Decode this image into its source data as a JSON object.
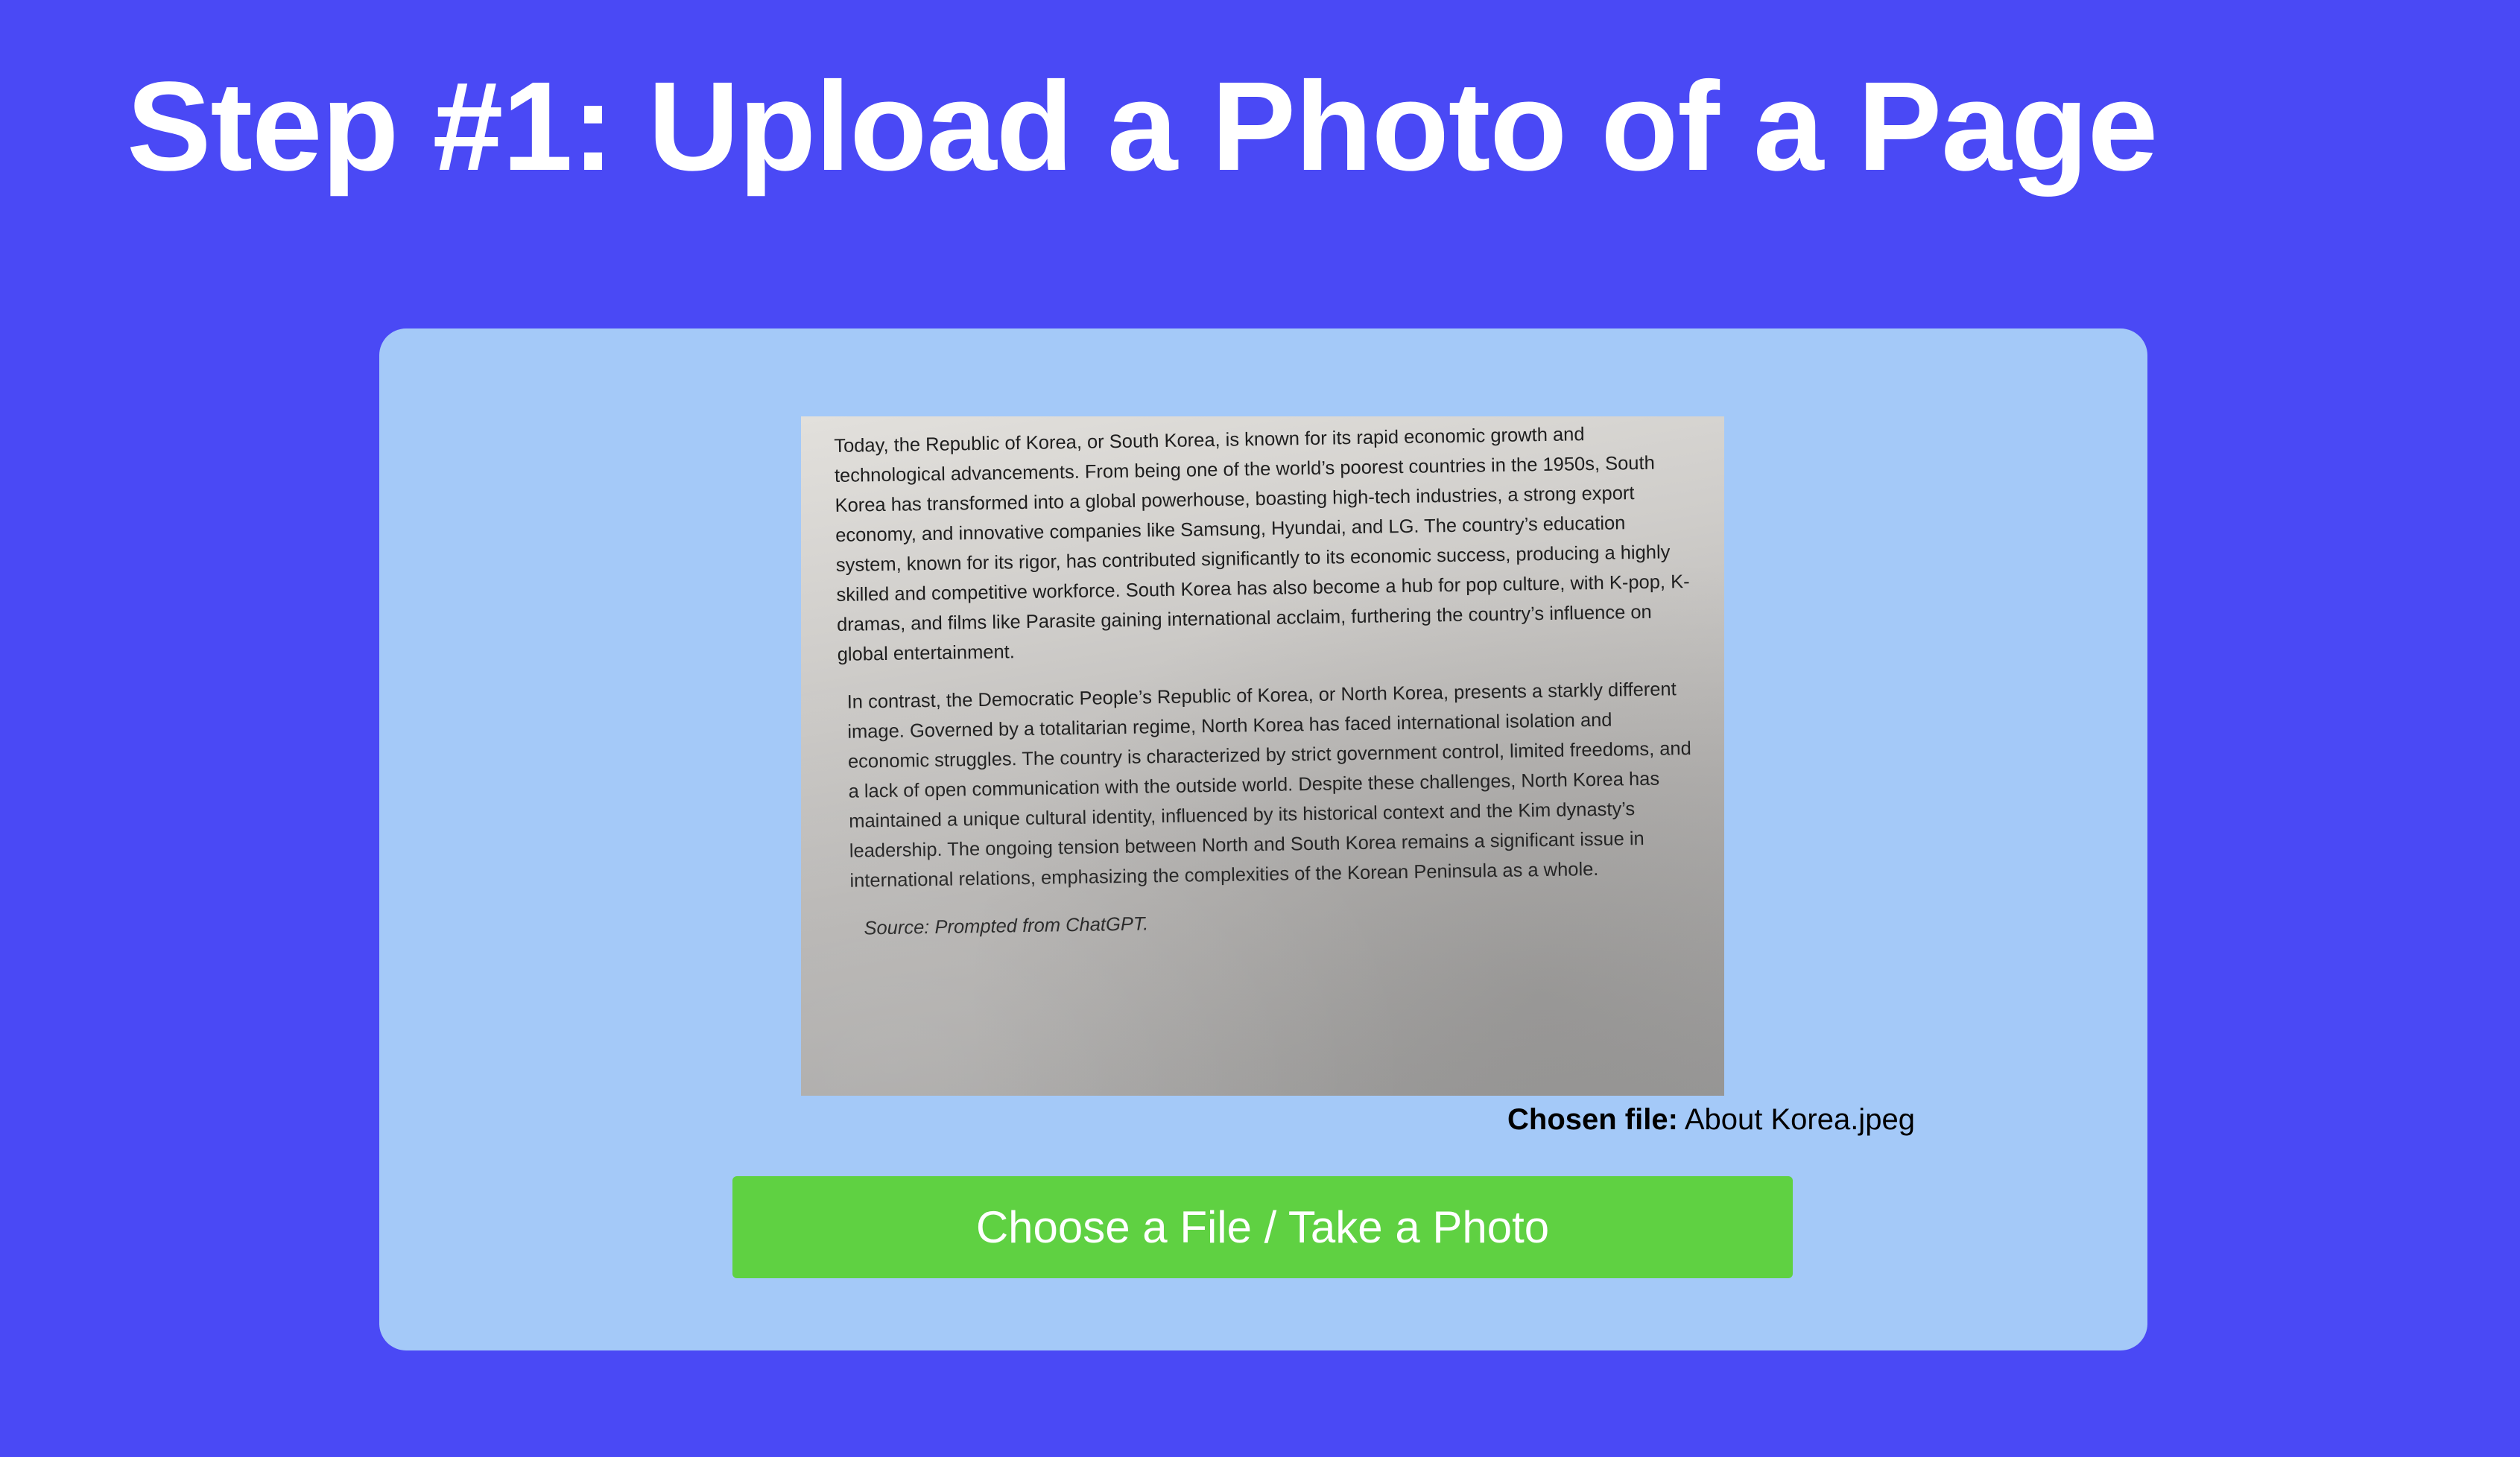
{
  "page": {
    "title": "Step #1: Upload a Photo of a Page",
    "background_color": "#4a49f5"
  },
  "upload_card": {
    "background_color": "#a4c9f8",
    "preview": {
      "paragraph_1": "Today, the Republic of Korea, or South Korea, is known for its rapid economic growth and technological advancements. From being one of the world’s poorest countries in the 1950s, South Korea has transformed into a global powerhouse, boasting high-tech industries, a strong export economy, and innovative companies like Samsung, Hyundai, and LG. The country’s education system, known for its rigor, has contributed significantly to its economic success, producing a highly skilled and competitive workforce. South Korea has also become a hub for pop culture, with K-pop, K-dramas, and films like Parasite gaining international acclaim, furthering the country’s influence on global entertainment.",
      "paragraph_2": "In contrast, the Democratic People’s Republic of Korea, or North Korea, presents a starkly different image. Governed by a totalitarian regime, North Korea has faced international isolation and economic struggles. The country is characterized by strict government control, limited freedoms, and a lack of open communication with the outside world. Despite these challenges, North Korea has maintained a unique cultural identity, influenced by its historical context and the Kim dynasty’s leadership. The ongoing tension between North and South Korea remains a significant issue in international relations, emphasizing the complexities of the Korean Peninsula as a whole.",
      "source": "Source: Prompted from ChatGPT."
    },
    "chosen_file": {
      "label": "Chosen file:",
      "name": "About Korea.jpeg"
    },
    "choose_button": {
      "label": "Choose a File / Take a Photo",
      "color": "#5fd142"
    }
  }
}
